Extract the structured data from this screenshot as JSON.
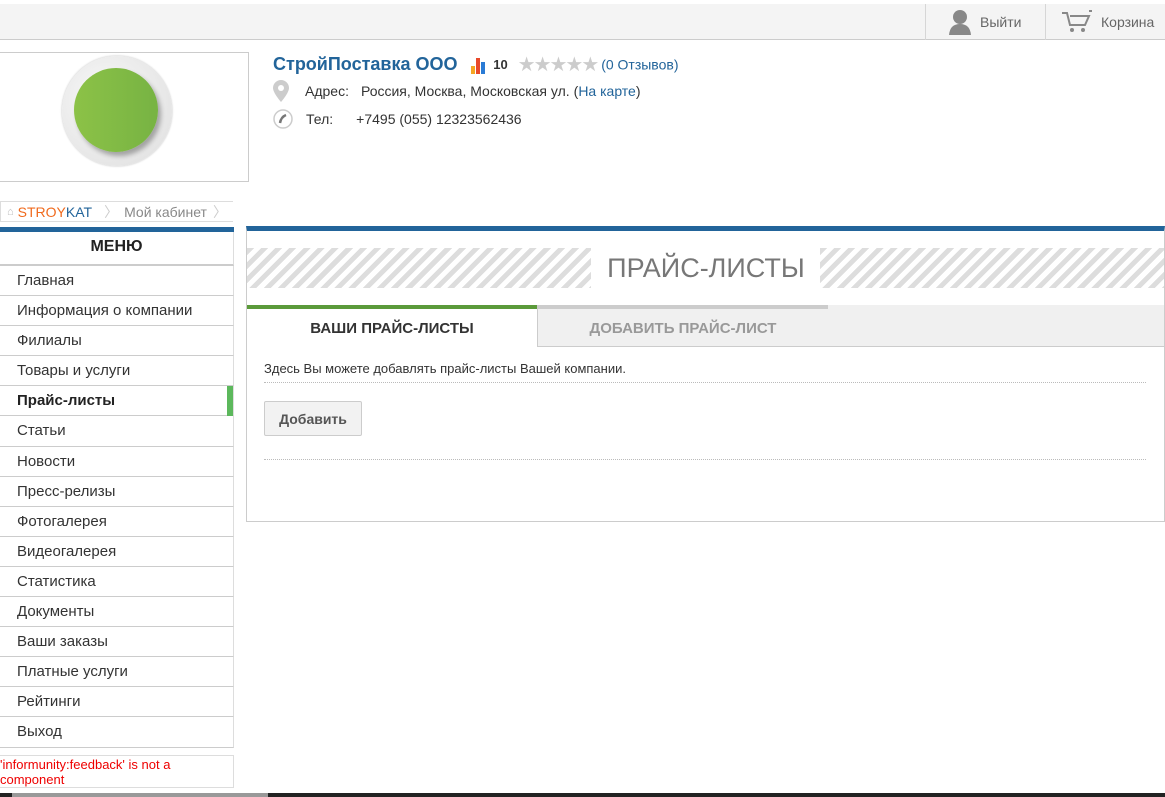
{
  "topbar": {
    "logout": "Выйти",
    "cart": "Корзина"
  },
  "company": {
    "name": "СтройПоставка ООО",
    "rating": "10",
    "stars": 0,
    "reviews": "(0 Отзывов)",
    "address_label": "Адрес:",
    "address": "Россия, Москва, Московская ул.",
    "map_link": "На карте",
    "phone_label": "Тел:",
    "phone": "+7495 (055) 12323562436"
  },
  "breadcrumb": {
    "home_a": "STROY",
    "home_b": "KAT",
    "current": "Мой кабинет"
  },
  "menu": {
    "title": "МЕНЮ",
    "items": [
      "Главная",
      "Информация о компании",
      "Филиалы",
      "Товары и услуги",
      "Прайс-листы",
      "Статьи",
      "Новости",
      "Пресс-релизы",
      "Фотогалерея",
      "Видеогалерея",
      "Статистика",
      "Документы",
      "Ваши заказы",
      "Платные услуги",
      "Рейтинги",
      "Выход"
    ],
    "active": "Прайс-листы"
  },
  "error": "'informunity:feedback' is not a component",
  "main": {
    "title": "ПРАЙС-ЛИСТЫ",
    "tabs": [
      "ВАШИ ПРАЙС-ЛИСТЫ",
      "ДОБАВИТЬ ПРАЙС-ЛИСТ"
    ],
    "description": "Здесь Вы можете добавлять прайс-листы Вашей компании.",
    "add_button": "Добавить"
  },
  "colors": {
    "brand": "#22649a",
    "accent_green": "#5b9a3a",
    "error": "#e00000"
  }
}
